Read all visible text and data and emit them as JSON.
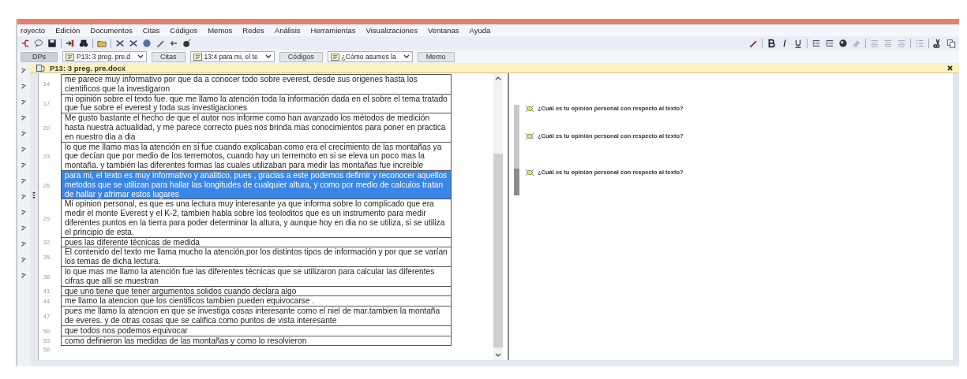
{
  "menu": [
    "royecto",
    "Edición",
    "Documentos",
    "Citas",
    "Códigos",
    "Memos",
    "Redes",
    "Análisis",
    "Herramientas",
    "Visualizaciones",
    "Ventanas",
    "Ayuda"
  ],
  "navigator": [
    {
      "kind": "button",
      "label": "DPs"
    },
    {
      "kind": "combo",
      "label": "P13: 3 preg. pre.d"
    },
    {
      "kind": "button",
      "label": "Citas"
    },
    {
      "kind": "combo",
      "label": "13:4 para mi, el te"
    },
    {
      "kind": "button",
      "label": "Códigos"
    },
    {
      "kind": "combo",
      "label": "¿Cómo asumes la"
    },
    {
      "kind": "button",
      "label": "Memo"
    }
  ],
  "document": {
    "title": "P13: 3 preg. pre.docx",
    "rows": [
      {
        "number": "14",
        "text": "me parece muy informativo por que da a conocer todo sobre everest, desde sus origenes hasta los cientificos que la investigaron",
        "selected": false
      },
      {
        "number": "17",
        "text": "mi opinión sobre el texto fue. que me llamo la atención toda la información dada en el sobre el tema tratado que fue sobre el everest y toda sus investigaciones",
        "selected": false
      },
      {
        "number": "20",
        "text": "Me gusto bastante el hecho de que el autor nos informe como han avanzado los métodos de medición hasta nuestra actualidad, y me parece correcto pues nos brinda mas conocimientos para poner en practica en nuestro dia a dia",
        "selected": false
      },
      {
        "number": "23",
        "text": "lo que me llamo mas la atención en si fue cuando explicaban como era el crecimiento de las montañas ya que decían que por medio de los terremotos, cuando hay un terremoto en si se eleva un poco mas la montaña. y también las diferentes formas las cuales utilizaban para medir las montañas fue increíble",
        "selected": false
      },
      {
        "number": "26",
        "text": "para mi, el texto es muy informativo y analitico, pues , gracias a este podemos defirnir y reconocer aquellos metodos que se utilizan para hallar las longitudes de cualquier altura, y como por medio de calculos tratan de hallar y afrimar estos lugares",
        "selected": true
      },
      {
        "number": "29",
        "text": "Mi opinion personal, es que es una lectura muy interesante ya que informa sobre lo complicado que era medir el monte Everest y el K-2, tambien habla sobre los teoloditos que es un instrumento para medir diferentes puntos en la tierra para poder determinar la altura, y aunque hoy en dia no se utiliza, si se utiliza el principio de esta.",
        "selected": false
      },
      {
        "number": "32",
        "text": "pues las diferente técnicas de medida",
        "selected": false
      },
      {
        "number": "35",
        "text": "El contenido del texto me llama mucho la atención,por los distintos tipos de información y por que se varían los temas de dicha lectura.",
        "selected": false
      },
      {
        "number": "38",
        "text": "lo que mas me llamo la atención fue las diferentes técnicas que se utilizaron para calcular las diferentes cifras que allí se muestran",
        "selected": false
      },
      {
        "number": "41",
        "text": "que uno tiene que tener argumentos solidos cuando declara algo",
        "selected": false
      },
      {
        "number": "44",
        "text": "me llamo la atencion que los cientificos tambien pueden equivocarse .",
        "selected": false
      },
      {
        "number": "47",
        "text": "pues me llamo la atencion en que se investiga cosas interesante como el niel de mar.tambien la montaña de everes. y de otras cosas que se califica como puntos de vista interesante",
        "selected": false
      },
      {
        "number": "50",
        "text": "que todos nos podemos equivocar",
        "selected": false
      },
      {
        "number": "53",
        "text": "como definieron las medidas de las montañas y como lo resolvieron",
        "selected": false
      }
    ],
    "last_line_number": "56"
  },
  "margin_codes": [
    {
      "label": "¿Cuál es tu opinión personal con respecto al texto?",
      "selected": false
    },
    {
      "label": "¿Cuál es tu opinión personal con respecto al texto?",
      "selected": false
    },
    {
      "label": "¿Cuál es tu opinión personal con respecto al texto?",
      "selected": true
    }
  ]
}
